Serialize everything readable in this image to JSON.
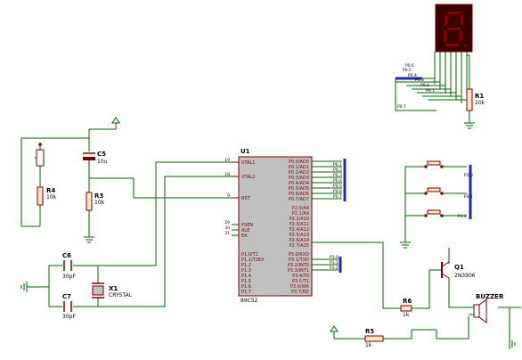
{
  "colors": {
    "wire": "#006400",
    "body": "#c0c0c0",
    "body_stroke": "#7a0000",
    "component": "#7a0000",
    "bus": "#1f2aa8",
    "display_body": "#3a0000",
    "display_segment": "#8a0000",
    "resistor_fill": "#f4e6c8",
    "label": "#000000"
  },
  "mcu": {
    "ref": "U1",
    "part": "89C52",
    "pins_left_top": [
      {
        "num": "19",
        "name": "XTAL1"
      },
      {
        "num": "18",
        "name": "XTAL2"
      },
      {
        "num": "9",
        "name": "RST"
      }
    ],
    "pins_left_mid": [
      {
        "num": "29",
        "name": "PSEN"
      },
      {
        "num": "30",
        "name": "ALE"
      },
      {
        "num": "31",
        "name": "EA"
      }
    ],
    "pins_left_bottom": [
      "P1.0/T2",
      "P1.1/T2EX",
      "P1.2",
      "P1.3",
      "P1.4",
      "P1.5",
      "P1.6",
      "P1.7"
    ],
    "pins_right_top": [
      "P0.0/AD0",
      "P0.1/AD1",
      "P0.2/AD2",
      "P0.3/AD3",
      "P0.4/AD4",
      "P0.5/AD5",
      "P0.6/AD6",
      "P0.7/AD7"
    ],
    "pins_right_mid": [
      "P2.0/A8",
      "P2.1/A9",
      "P2.2/A10",
      "P2.3/A11",
      "P2.4/A12",
      "P2.5/A13",
      "P2.6/A14",
      "P2.7/A15"
    ],
    "pins_right_bottom": [
      "P3.0/RXD",
      "P3.1/TXD",
      "P3.2/INT0",
      "P3.3/INT1",
      "P3.4/T0",
      "P3.5/T1",
      "P3.6/WR",
      "P3.7/RD"
    ]
  },
  "net_labels": {
    "p0_bus": [
      "P0.1",
      "P0.2",
      "P0.3",
      "P0.4",
      "P0.5",
      "P0.6",
      "P0.7"
    ],
    "p3_bus": [
      "P3.0",
      "P3.1",
      "P3.2"
    ],
    "display_side": [
      "P0.6",
      "P0.5",
      "P0.4",
      "P0.3",
      "P0.2",
      "P0.1",
      "P0.7"
    ],
    "button_side": [
      "P3.0",
      "P3.1",
      "P3.2"
    ]
  },
  "components": {
    "c5": {
      "ref": "C5",
      "value": "10u"
    },
    "r4": {
      "ref": "R4",
      "value": "10k"
    },
    "r3": {
      "ref": "R3",
      "value": "10k"
    },
    "c6": {
      "ref": "C6",
      "value": "30pF"
    },
    "c7": {
      "ref": "C7",
      "value": "30pF"
    },
    "x1": {
      "ref": "X1",
      "value": "CRYSTAL"
    },
    "r1": {
      "ref": "R1",
      "value": "10k"
    },
    "r6": {
      "ref": "R6",
      "value": "1k"
    },
    "r5": {
      "ref": "R5",
      "value": "1k"
    },
    "q1": {
      "ref": "Q1",
      "value": "2N3906"
    },
    "buzzer": {
      "ref": "BUZZER"
    }
  }
}
